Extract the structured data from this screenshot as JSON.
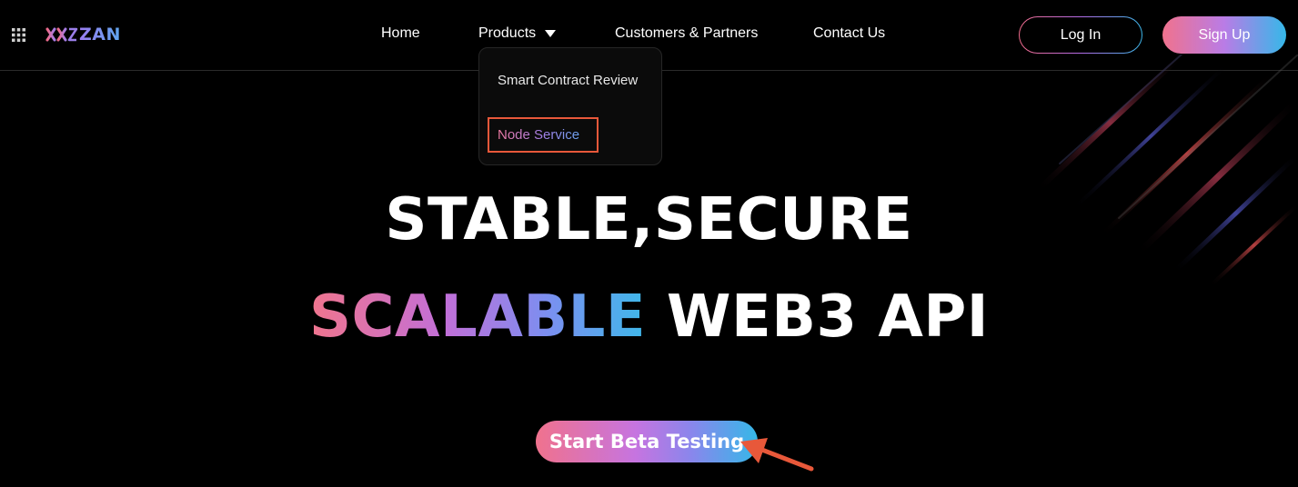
{
  "header": {
    "logo_text": "ZAN",
    "nav": [
      {
        "label": "Home"
      },
      {
        "label": "Products"
      },
      {
        "label": "Customers & Partners"
      },
      {
        "label": "Contact Us"
      }
    ],
    "login_label": "Log In",
    "signup_label": "Sign Up"
  },
  "products_menu": {
    "items": [
      {
        "label": "Smart Contract Review"
      },
      {
        "label": "Node Service"
      }
    ]
  },
  "hero": {
    "line1": "STABLE,SECURE",
    "line2_gradient": "SCALABLE",
    "line2_rest": "WEB3 API",
    "cta_label": "Start Beta Testing"
  },
  "icons": {
    "apps": "grid-icon",
    "logo": "zan-logo-icon",
    "products_caret": "caret-down-icon",
    "annotation": "arrow-icon"
  },
  "colors": {
    "background": "#000000",
    "gradient_start": "#f0728d",
    "gradient_mid": "#b97ce6",
    "gradient_end": "#35b8e8",
    "annotation": "#e8583a"
  }
}
